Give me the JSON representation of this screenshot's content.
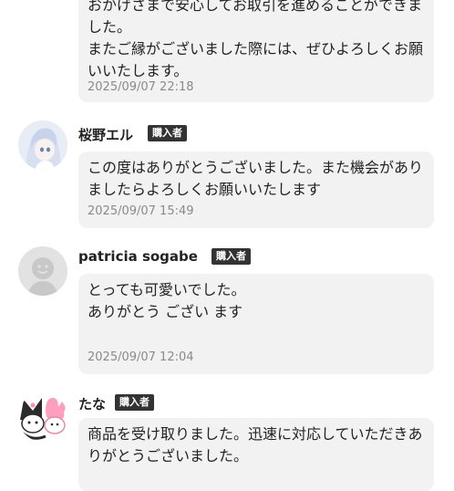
{
  "reviews": [
    {
      "message": "おかげさまで安心してお取引を進めることができました。\nまたご縁がございました際には、ぜひよろしくお願いいたします。",
      "timestamp": "2025/09/07 22:18"
    },
    {
      "name": "桜野エル",
      "badge": "購入者",
      "message": "この度はありがとうございました。また機会がありましたらよろしくお願いいたします",
      "timestamp": "2025/09/07 15:49"
    },
    {
      "name": "patricia sogabe",
      "badge": "購入者",
      "message": "とっても可愛いでした。\nありがとう ござい ます",
      "timestamp": "2025/09/07 12:04"
    },
    {
      "name": "たな",
      "badge": "購入者",
      "message": "商品を受け取りました。迅速に対応していただきありがとうございました。"
    }
  ],
  "colors": {
    "bubble": "#f2f2f2",
    "badge": "#333333",
    "timestamp": "#8a8a8a"
  }
}
